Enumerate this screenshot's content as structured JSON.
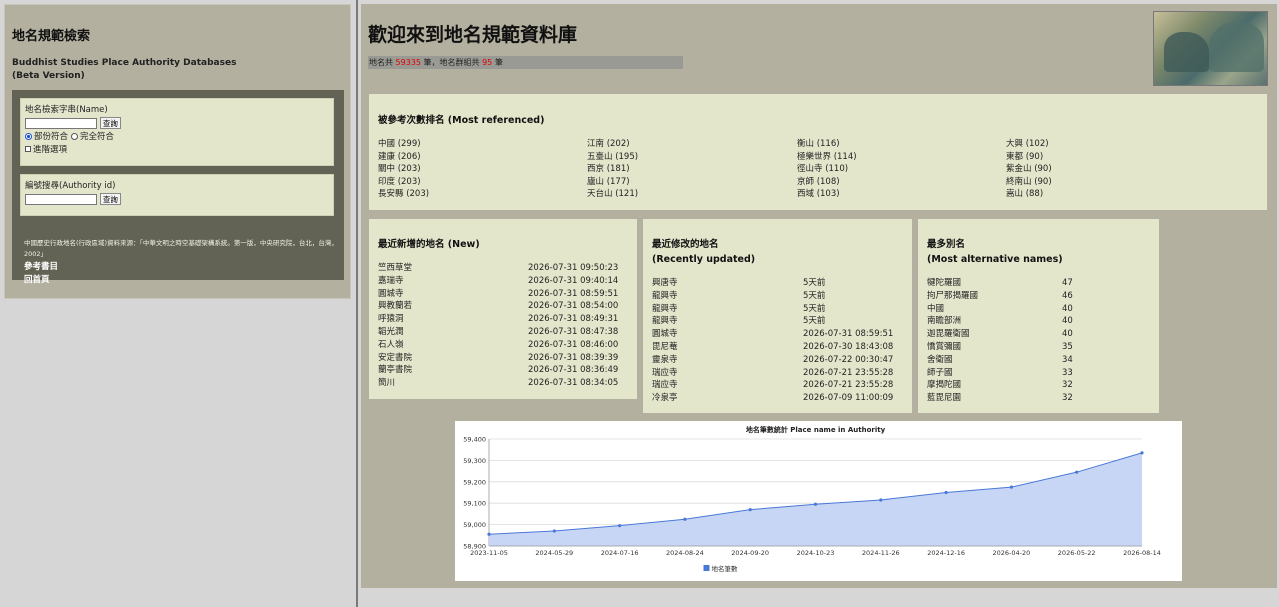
{
  "left": {
    "title": "地名規範檢索",
    "subtitle_line1": "Buddhist Studies Place Authority Databases",
    "subtitle_line2": "(Beta Version)",
    "name_search": {
      "label": "地名檢索字串(Name)",
      "value": "",
      "button": "查詢",
      "option_partial": "部份符合",
      "option_exact": "完全符合",
      "option_advanced": "進階選項"
    },
    "id_search": {
      "label": "編號搜尋(Authority id)",
      "value": "",
      "button": "查詢"
    },
    "source_note": "中國歷史行政地名(行政區域)資料來源：「中華文明之時空基礎架構系統。第一版，中央研究院，台北，台灣，2002」",
    "link_references": "參考書目",
    "link_home": "回首頁"
  },
  "main": {
    "title": "歡迎來到地名規範資料庫",
    "count": {
      "prefix": "地名共",
      "places": "59335",
      "mid": "筆，地名群組共",
      "groups": "95",
      "suffix": "筆"
    },
    "most_referenced": {
      "title": "被參考次數排名 (Most referenced)",
      "columns": [
        [
          "中國 (299)",
          "建康 (206)",
          "關中 (203)",
          "印度 (203)",
          "長安縣 (203)"
        ],
        [
          "江南 (202)",
          "五臺山 (195)",
          "西京 (181)",
          "廬山 (177)",
          "天台山 (121)"
        ],
        [
          "衡山 (116)",
          "極樂世界 (114)",
          "徑山寺 (110)",
          "京師 (108)",
          "西域 (103)"
        ],
        [
          "大興 (102)",
          "東都 (90)",
          "紫金山 (90)",
          "終南山 (90)",
          "嵩山 (88)"
        ]
      ]
    },
    "recent_new": {
      "title": "最近新增的地名 (New)",
      "rows": [
        {
          "name": "竺西草堂",
          "time": "2026-07-31 09:50:23"
        },
        {
          "name": "嘉瑞寺",
          "time": "2026-07-31 09:40:14"
        },
        {
          "name": "圓城寺",
          "time": "2026-07-31 08:59:51"
        },
        {
          "name": "興教蘭若",
          "time": "2026-07-31 08:54:00"
        },
        {
          "name": "呼猿洞",
          "time": "2026-07-31 08:49:31"
        },
        {
          "name": "韜光澗",
          "time": "2026-07-31 08:47:38"
        },
        {
          "name": "石人嶺",
          "time": "2026-07-31 08:46:00"
        },
        {
          "name": "安定書院",
          "time": "2026-07-31 08:39:39"
        },
        {
          "name": "蘭亭書院",
          "time": "2026-07-31 08:36:49"
        },
        {
          "name": "簡川",
          "time": "2026-07-31 08:34:05"
        }
      ]
    },
    "recent_updated": {
      "title_line1": "最近修改的地名",
      "title_line2": "(Recently updated)",
      "rows": [
        {
          "name": "興唐寺",
          "time": "5天前"
        },
        {
          "name": "龍興寺",
          "time": "5天前"
        },
        {
          "name": "龍興寺",
          "time": "5天前"
        },
        {
          "name": "龍興寺",
          "time": "5天前"
        },
        {
          "name": "圓城寺",
          "time": "2026-07-31 08:59:51"
        },
        {
          "name": "毘尼菴",
          "time": "2026-07-30 18:43:08"
        },
        {
          "name": "靈泉寺",
          "time": "2026-07-22 00:30:47"
        },
        {
          "name": "瑞应寺",
          "time": "2026-07-21 23:55:28"
        },
        {
          "name": "瑞应寺",
          "time": "2026-07-21 23:55:28"
        },
        {
          "name": "冷泉亭",
          "time": "2026-07-09 11:00:09"
        }
      ]
    },
    "most_alt": {
      "title_line1": "最多別名",
      "title_line2": "(Most alternative names)",
      "rows": [
        {
          "name": "犍陀羅國",
          "count": "47"
        },
        {
          "name": "拘尸那揭羅國",
          "count": "46"
        },
        {
          "name": "中國",
          "count": "40"
        },
        {
          "name": "南瞻部洲",
          "count": "40"
        },
        {
          "name": "迦毘羅衛國",
          "count": "40"
        },
        {
          "name": "憍賞彌國",
          "count": "35"
        },
        {
          "name": "舍衛國",
          "count": "34"
        },
        {
          "name": "師子國",
          "count": "33"
        },
        {
          "name": "摩揭陀國",
          "count": "32"
        },
        {
          "name": "藍毘尼園",
          "count": "32"
        }
      ]
    }
  },
  "chart_data": {
    "type": "area",
    "title": "地名筆數統計 Place name in Authority",
    "x": [
      "2023-11-05",
      "2024-05-29",
      "2024-07-16",
      "2024-08-24",
      "2024-09-20",
      "2024-10-23",
      "2024-11-26",
      "2024-12-16",
      "2026-04-20",
      "2026-05-22",
      "2026-08-14"
    ],
    "series": [
      {
        "name": "地名筆數",
        "values": [
          58955,
          58970,
          58995,
          59025,
          59070,
          59095,
          59115,
          59150,
          59175,
          59245,
          59335
        ]
      }
    ],
    "ylim": [
      58900,
      59400
    ],
    "yticks": [
      "58,900",
      "59,000",
      "59,100",
      "59,200",
      "59,300",
      "59,400"
    ],
    "ytick_values": [
      58900,
      59000,
      59100,
      59200,
      59300,
      59400
    ],
    "legend": "bottom-center",
    "grid": true,
    "color": "#4a78d8",
    "fill": "#c7d6f5"
  }
}
